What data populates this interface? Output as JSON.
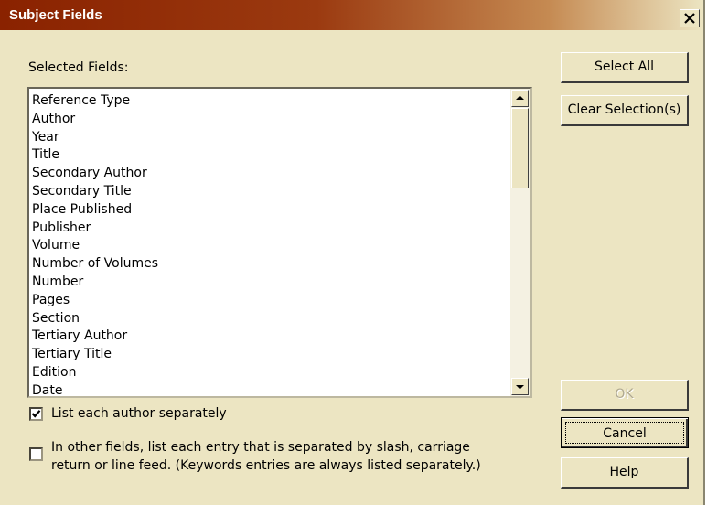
{
  "dialog": {
    "title": "Subject Fields",
    "close_icon": "close-x-icon"
  },
  "fields_label": "Selected Fields:",
  "fields": [
    "Reference Type",
    "Author",
    "Year",
    "Title",
    "Secondary Author",
    "Secondary Title",
    "Place Published",
    "Publisher",
    "Volume",
    "Number of Volumes",
    "Number",
    "Pages",
    "Section",
    "Tertiary Author",
    "Tertiary Title",
    "Edition",
    "Date"
  ],
  "buttons": {
    "select_all": "Select All",
    "clear_selection": "Clear Selection(s)",
    "ok": "OK",
    "cancel": "Cancel",
    "help": "Help"
  },
  "options": {
    "list_author_label": "List each author separately",
    "list_author_checked": true,
    "other_fields_label_line1": "In other fields, list each entry that is separated by slash, carriage",
    "other_fields_label_line2": "return or line feed. (Keywords entries are always listed separately.)",
    "other_fields_checked": false
  },
  "colors": {
    "dialog_bg": "#ece5c2",
    "title_start": "#8a2200",
    "title_end": "#ece5c2"
  }
}
